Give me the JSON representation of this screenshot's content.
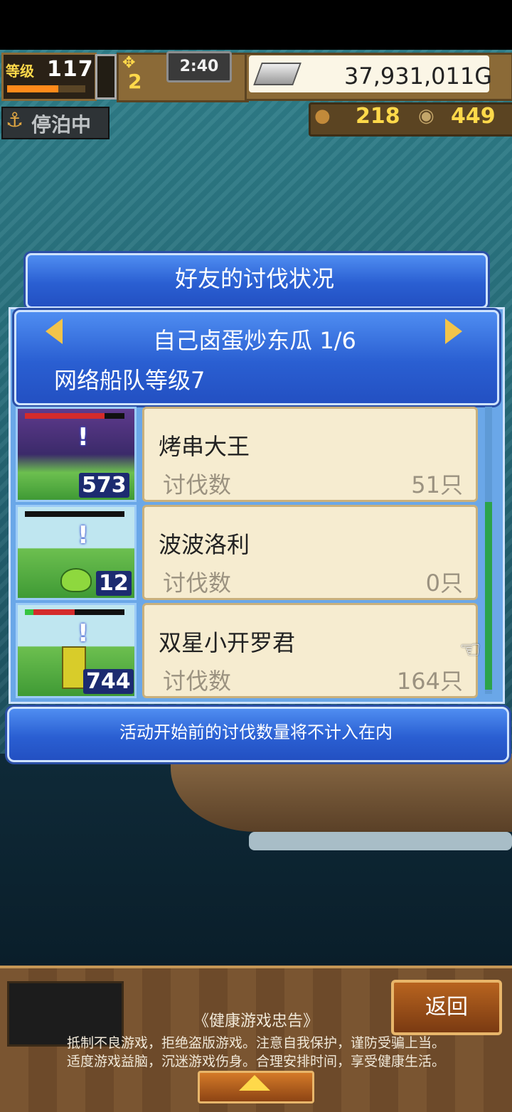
{
  "hud": {
    "level_tag": "等级",
    "level_value": "117",
    "level_progress": 0.65,
    "crew_value": "2",
    "clock": "2:40",
    "gold": "37,931,011G",
    "anchor_status": "停泊中",
    "resource1_value": "218",
    "resource2_value": "449"
  },
  "dialog": {
    "title": "好友的讨伐状况",
    "friend_name": "自己卤蛋炒东瓜 1/6",
    "fleet_level": "网络船队等级7",
    "rows": [
      {
        "name": "烤串大王",
        "label": "讨伐数",
        "count": "51只",
        "level": "573",
        "hp": 0.8
      },
      {
        "name": "波波洛利",
        "label": "讨伐数",
        "count": "0只",
        "level": "12",
        "hp": 0.0
      },
      {
        "name": "双星小开罗君",
        "label": "讨伐数",
        "count": "164只",
        "level": "744",
        "hp": 0.5
      }
    ],
    "note": "活动开始前的讨伐数量将不计入在内"
  },
  "footer": {
    "back_label": "返回",
    "notice_title": "《健康游戏忠告》",
    "notice_line1": "抵制不良游戏，拒绝盗版游戏。注意自我保护，谨防受骗上当。",
    "notice_line2": "适度游戏益脑，沉迷游戏伤身。合理安排时间，享受健康生活。"
  },
  "colors": {
    "panel_blue": "#2a5fd2",
    "gold_text": "#ffd94a",
    "card_bg": "#f6ecd0"
  },
  "icons": [
    "anchor-icon",
    "coin-bar-icon",
    "pointing-hand-icon",
    "arrow-left-icon",
    "arrow-right-icon",
    "arrow-up-icon"
  ]
}
